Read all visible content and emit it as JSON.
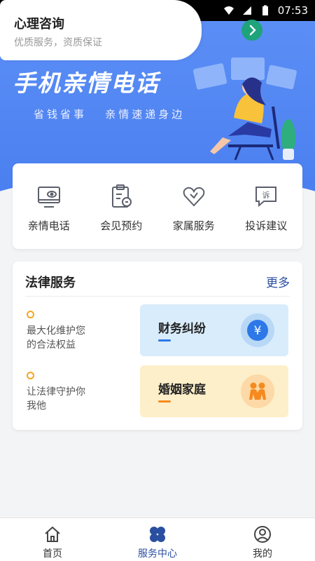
{
  "status_bar": {
    "time": "07:53"
  },
  "hero": {
    "title": "手机亲情电话",
    "subtitle": "省钱省事   亲情速递身边"
  },
  "quick_actions": [
    {
      "label": "亲情电话",
      "icon": "monitor-eye-icon"
    },
    {
      "label": "会见预约",
      "icon": "clipboard-stamp-icon"
    },
    {
      "label": "家属服务",
      "icon": "heart-icon"
    },
    {
      "label": "投诉建议",
      "icon": "complaint-bubble-icon"
    }
  ],
  "legal": {
    "title": "法律服务",
    "more": "更多",
    "bullets": [
      {
        "text": "最大化维护您\n的合法权益"
      },
      {
        "text": "让法律守护你\n我他"
      }
    ],
    "tiles": [
      {
        "label": "财务纠纷",
        "icon": "yuan-coin-icon"
      },
      {
        "label": "婚姻家庭",
        "icon": "couple-icon"
      }
    ]
  },
  "psych": {
    "title": "心理咨询",
    "subtitle": "优质服务，资质保证"
  },
  "tabbar": {
    "tabs": [
      {
        "label": "首页",
        "icon": "home-icon"
      },
      {
        "label": "服务中心",
        "icon": "clover-grid-icon"
      },
      {
        "label": "我的",
        "icon": "user-icon"
      }
    ],
    "active_index": 1
  },
  "colors": {
    "hero_blue": "#4a7ff0",
    "accent_dark_blue": "#2a4fa0",
    "accent_orange": "#f5a623",
    "accent_green": "#1fa37a"
  }
}
